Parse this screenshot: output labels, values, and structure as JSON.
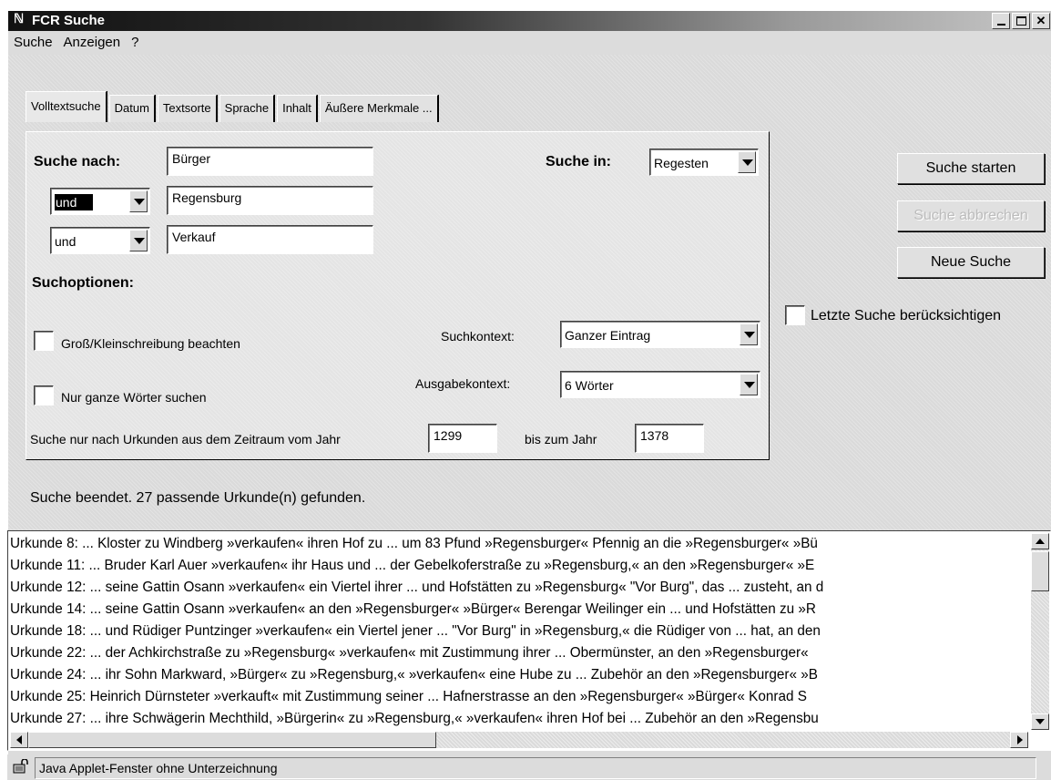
{
  "window": {
    "title": "FCR Suche",
    "icon": "applet-icon"
  },
  "menu": [
    "Suche",
    "Anzeigen",
    "?"
  ],
  "tabs": [
    "Volltextsuche",
    "Datum",
    "Textsorte",
    "Sprache",
    "Inhalt",
    "Äußere Merkmale ..."
  ],
  "search": {
    "label": "Suche nach:",
    "term1": "Bürger",
    "op2": "und",
    "term2": "Regensburg",
    "op3": "und",
    "term3": "Verkauf",
    "in_label": "Suche in:",
    "in_value": "Regesten"
  },
  "options": {
    "label": "Suchoptionen:",
    "case_label": "Groß/Kleinschreibung beachten",
    "whole_label": "Nur ganze Wörter suchen",
    "context_label": "Suchkontext:",
    "context_value": "Ganzer Eintrag",
    "output_label": "Ausgabekontext:",
    "output_value": "6 Wörter",
    "range_label": "Suche nur nach Urkunden aus dem Zeitraum vom Jahr",
    "year_from": "1299",
    "range_to_label": "bis zum Jahr",
    "year_to": "1378"
  },
  "buttons": {
    "start": "Suche starten",
    "abort": "Suche abbrechen",
    "new": "Neue Suche",
    "last_label": "Letzte Suche berücksichtigen"
  },
  "status": "Suche beendet. 27 passende Urkunde(n) gefunden.",
  "results": [
    "Urkunde 8: ... Kloster zu Windberg »verkaufen« ihren Hof zu ... um 83 Pfund »Regensburger« Pfennig an die »Regensburger« »Bü",
    "Urkunde 11: ... Bruder Karl Auer »verkaufen« ihr Haus und ... der Gebelkoferstraße zu »Regensburg,« an den »Regensburger« »E",
    "Urkunde 12: ... seine Gattin Osann »verkaufen« ein Viertel ihrer ... und Hofstätten zu »Regensburg« \"Vor Burg\", das ... zusteht, an d",
    "Urkunde 14: ... seine Gattin Osann »verkaufen« an den »Regensburger« »Bürger« Berengar Weilinger ein ... und Hofstätten zu »R",
    "Urkunde 18: ... und Rüdiger Puntzinger »verkaufen« ein Viertel jener ... \"Vor Burg\" in »Regensburg,« die Rüdiger von ... hat, an den",
    "Urkunde 22: ... der Achkirchstraße zu »Regensburg« »verkaufen« mit Zustimmung ihrer ... Obermünster, an den »Regensburger«",
    "Urkunde 24: ... ihr Sohn Markward, »Bürger« zu »Regensburg,« »verkaufen« eine Hube zu ... Zubehör an den »Regensburger« »B",
    "Urkunde 25: Heinrich Dürnsteter »verkauft« mit Zustimmung seiner ... Hafnerstrasse an den »Regensburger« »Bürger« Konrad S",
    "Urkunde 27: ... ihre Schwägerin Mechthild, »Bürgerin« zu »Regensburg,« »verkaufen« ihren Hof bei ... Zubehör an den »Regensbu"
  ],
  "statusbar": "Java Applet-Fenster ohne Unterzeichnung"
}
